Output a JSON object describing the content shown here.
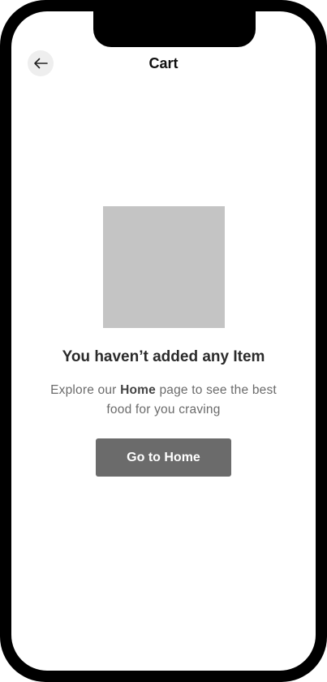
{
  "header": {
    "title": "Cart",
    "back_icon": "arrow-left-icon"
  },
  "empty_state": {
    "title": "You haven’t added any Item",
    "desc_prefix": "Explore our ",
    "desc_emphasis": "Home",
    "desc_suffix": " page to see the best food for you craving",
    "button_label": "Go to Home"
  },
  "colors": {
    "frame": "#000000",
    "placeholder": "#c4c4c4",
    "button": "#6b6b6b",
    "back_button_bg": "#eeeeee"
  }
}
